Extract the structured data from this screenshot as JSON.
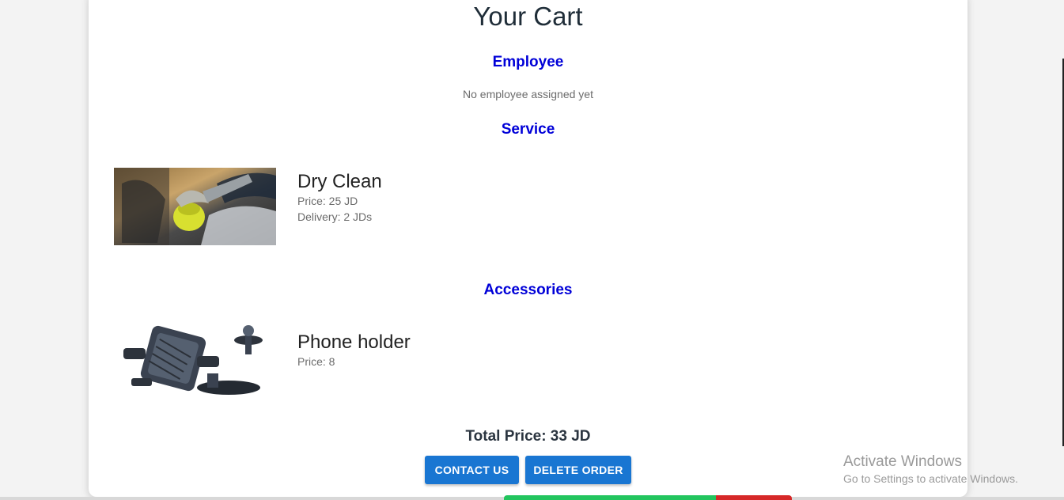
{
  "page": {
    "title": "Your Cart"
  },
  "employee": {
    "heading": "Employee",
    "status": "No employee assigned yet"
  },
  "service": {
    "heading": "Service",
    "item": {
      "name": "Dry Clean",
      "price": "Price: 25 JD",
      "delivery": "Delivery: 2 JDs"
    }
  },
  "accessories": {
    "heading": "Accessories",
    "item": {
      "name": "Phone holder",
      "price": "Price: 8"
    }
  },
  "summary": {
    "total": "Total Price: 33 JD"
  },
  "actions": {
    "contact_label": "CONTACT US",
    "delete_label": "DELETE ORDER"
  },
  "watermark": {
    "title": "Activate Windows",
    "subtitle": "Go to Settings to activate Windows."
  },
  "colors": {
    "heading": "#0000d8",
    "button": "#1976d2",
    "background": "#f3f3f3"
  }
}
